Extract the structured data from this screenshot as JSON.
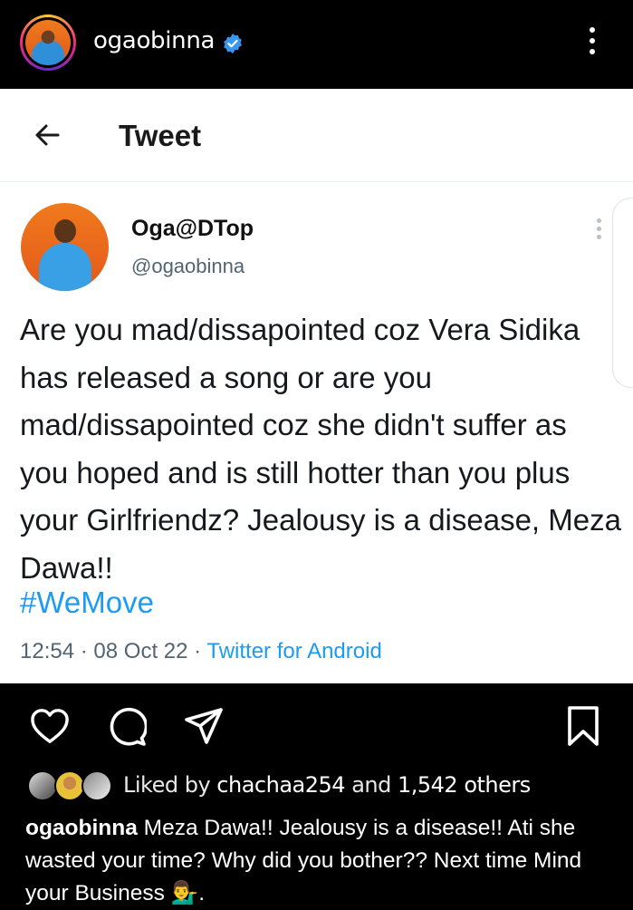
{
  "instagram": {
    "username": "ogaobinna",
    "verified_icon": "verified-badge-icon",
    "menu_icon": "more-vertical-icon"
  },
  "tweet": {
    "header_title": "Tweet",
    "back_icon": "back-arrow-icon",
    "display_name": "Oga@DTop",
    "handle": "@ogaobinna",
    "text": "Are you mad/dissapointed coz Vera Sidika has released a song or are you mad/dissapointed coz she didn't suffer as you hoped and is still hotter than you plus your Girlfriendz? Jealousy is a disease, Meza Dawa!!",
    "hashtag": "#WeMove",
    "time": "12:54",
    "date": "08 Oct 22",
    "separator": "·",
    "source": "Twitter for Android"
  },
  "actions": {
    "like_icon": "heart-icon",
    "comment_icon": "comment-icon",
    "share_icon": "send-icon",
    "save_icon": "bookmark-icon"
  },
  "likes": {
    "prefix": "Liked by",
    "user": "chachaa254",
    "and": "and",
    "others": "1,542 others"
  },
  "caption": {
    "username": "ogaobinna",
    "text": "Meza Dawa!! Jealousy is a disease!! Ati she wasted your time? Why did you bother?? Next time Mind your Business 💁‍♂️."
  },
  "colors": {
    "twitter_blue": "#1d9bf0",
    "instagram_bg": "#000000",
    "verified_blue": "#3797f0"
  }
}
